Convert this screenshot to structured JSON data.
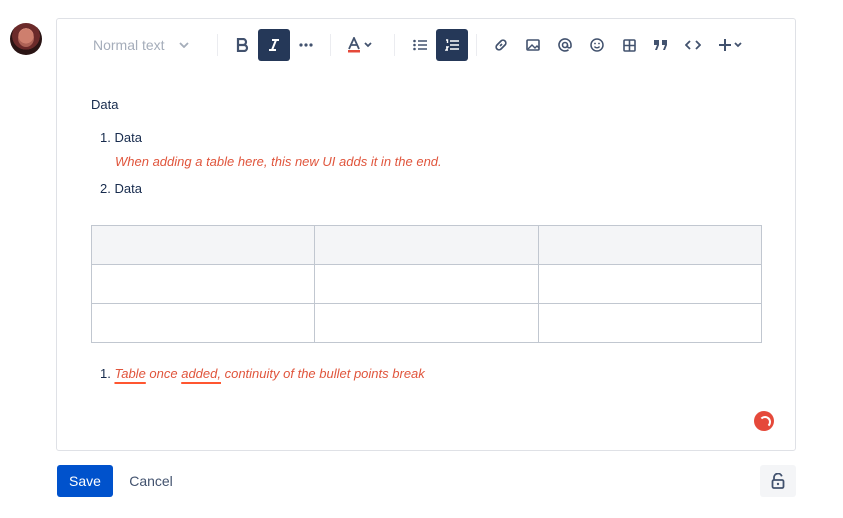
{
  "toolbar": {
    "text_style": "Normal text",
    "icons": [
      "bold-icon",
      "italic-icon",
      "more-formatting-icon",
      "text-color-icon",
      "bullet-list-icon",
      "numbered-list-icon",
      "link-icon",
      "image-icon",
      "mention-icon",
      "emoji-icon",
      "table-icon",
      "quote-icon",
      "code-icon",
      "insert-icon"
    ]
  },
  "content": {
    "paragraph": "Data",
    "list1": [
      {
        "marker": "1.",
        "text": "Data",
        "note": "When adding a table here, this new UI adds it in the end."
      },
      {
        "marker": "2.",
        "text": "Data"
      }
    ],
    "table": {
      "rows": 3,
      "cols": 3
    },
    "list2": {
      "marker": "1.",
      "word1": "Table",
      "text_mid": " once ",
      "word2": "added,",
      "text_end": " continuity of the bullet points break"
    }
  },
  "actions": {
    "save": "Save",
    "cancel": "Cancel"
  },
  "colors": {
    "accent": "#0052cc",
    "toolbar_active": "#253858",
    "annotation": "#e0553c"
  }
}
